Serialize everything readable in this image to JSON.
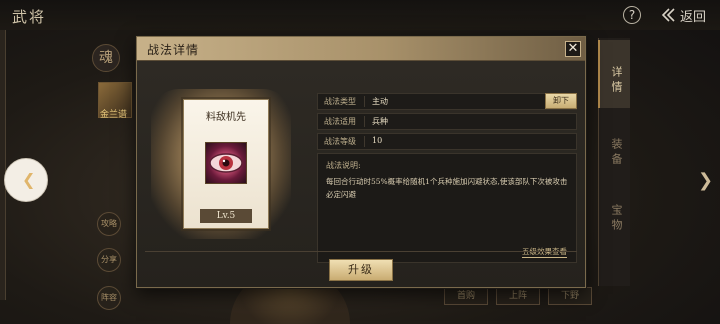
{
  "header": {
    "title": "武将",
    "help_label": "?",
    "back_label": "返回"
  },
  "background": {
    "soul_label": "魂",
    "golden_item_label": "金兰谱",
    "side_pills": [
      "攻略",
      "分享",
      "阵容"
    ],
    "right_tabs": [
      "详情",
      "装备",
      "宝物"
    ],
    "bottom_buttons": [
      "首购",
      "上阵",
      "下野"
    ]
  },
  "modal": {
    "title": "战法详情",
    "close_label": "✕",
    "skill": {
      "name": "料敌机先",
      "level": "Lv.5"
    },
    "details": [
      {
        "label": "战法类型",
        "value": "主动"
      },
      {
        "label": "战法适用",
        "value": "兵种"
      },
      {
        "label": "战法等级",
        "value": "10"
      }
    ],
    "unequip_label": "卸下",
    "description_heading": "战法说明:",
    "description_text": "每回合行动时55%概率给随机1个兵种施加闪避状态,使该部队下次被攻击必定闪避",
    "link_label": "五级效果查看",
    "upgrade_label": "升级"
  }
}
